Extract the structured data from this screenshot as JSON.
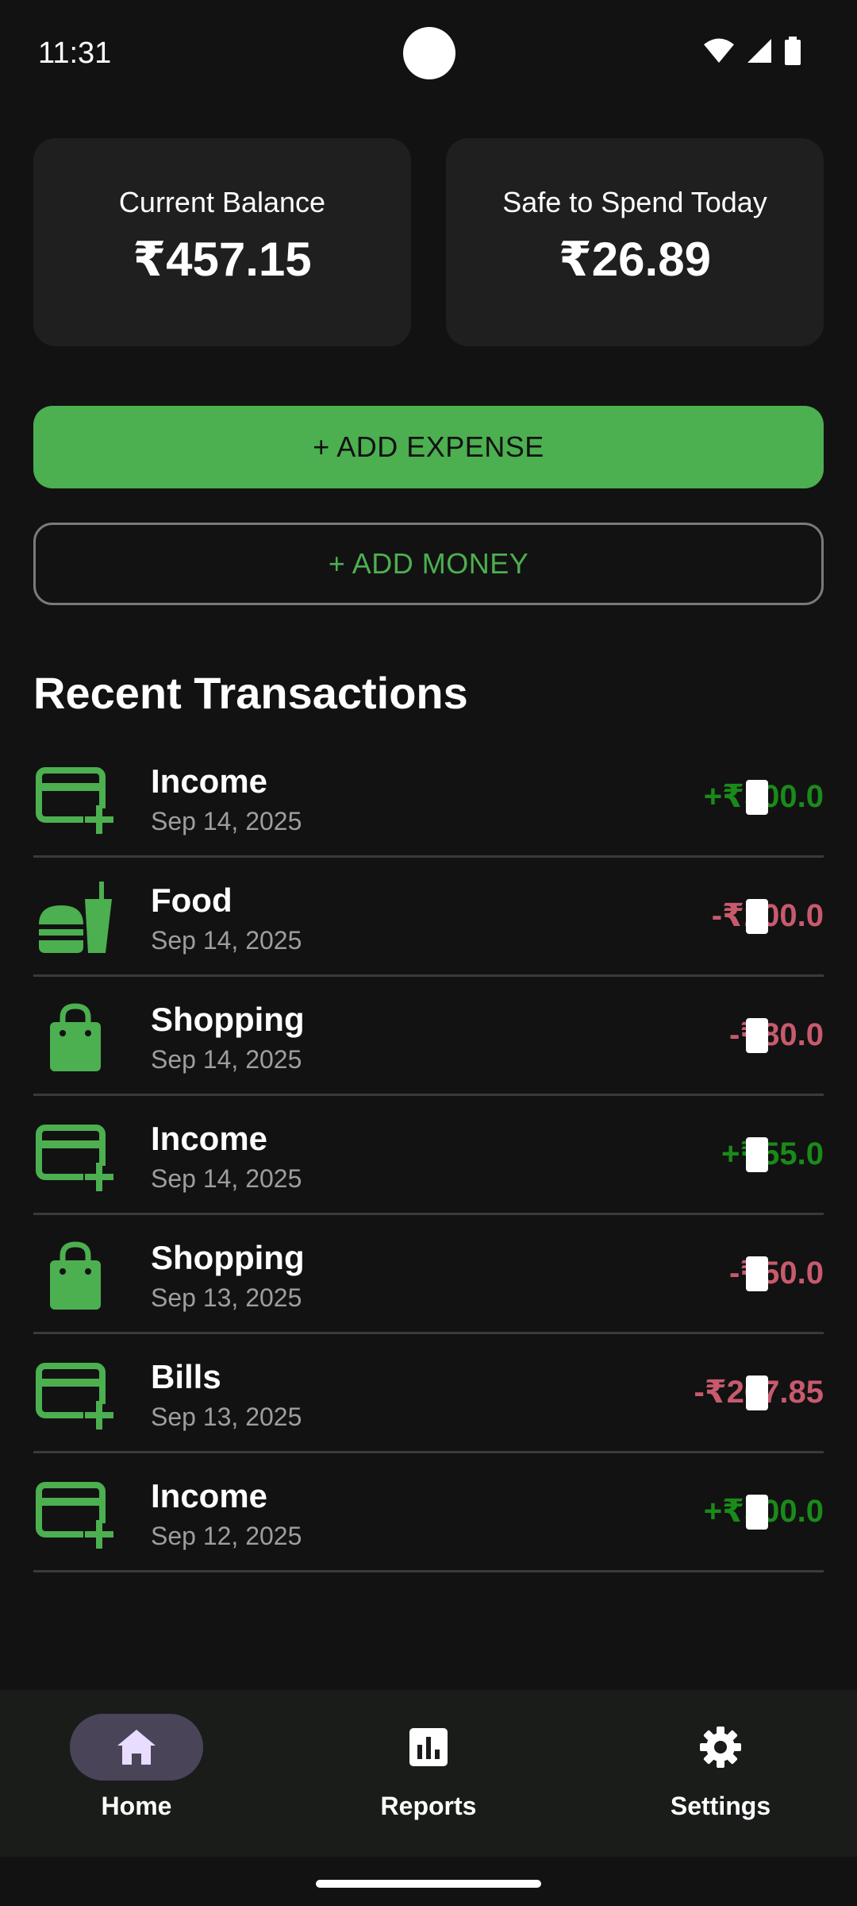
{
  "status_bar": {
    "time": "11:31"
  },
  "summary": {
    "balance_label": "Current Balance",
    "balance_value": "₹457.15",
    "safe_label": "Safe to Spend Today",
    "safe_value": "₹26.89"
  },
  "actions": {
    "add_expense": "+ ADD EXPENSE",
    "add_money": "+ ADD MONEY"
  },
  "recent": {
    "title": "Recent Transactions",
    "items": [
      {
        "title": "Income",
        "date": "Sep 14, 2025",
        "amount": "+₹500.0",
        "type": "pos",
        "icon": "income-card-icon"
      },
      {
        "title": "Food",
        "date": "Sep 14, 2025",
        "amount": "-₹200.0",
        "type": "neg",
        "icon": "fastfood-icon"
      },
      {
        "title": "Shopping",
        "date": "Sep 14, 2025",
        "amount": "-₹80.0",
        "type": "neg",
        "icon": "shopping-bag-icon"
      },
      {
        "title": "Income",
        "date": "Sep 14, 2025",
        "amount": "+₹55.0",
        "type": "pos",
        "icon": "income-card-icon"
      },
      {
        "title": "Shopping",
        "date": "Sep 13, 2025",
        "amount": "-₹50.0",
        "type": "neg",
        "icon": "shopping-bag-icon"
      },
      {
        "title": "Bills",
        "date": "Sep 13, 2025",
        "amount": "-₹267.85",
        "type": "neg",
        "icon": "income-card-icon"
      },
      {
        "title": "Income",
        "date": "Sep 12, 2025",
        "amount": "+₹500.0",
        "type": "pos",
        "icon": "income-card-icon"
      }
    ]
  },
  "nav": {
    "home": "Home",
    "reports": "Reports",
    "settings": "Settings"
  },
  "colors": {
    "accent": "#4caf50",
    "positive": "#1a8a1a",
    "negative": "#c85a6e",
    "background": "#121212",
    "card": "#1f1f1f"
  }
}
